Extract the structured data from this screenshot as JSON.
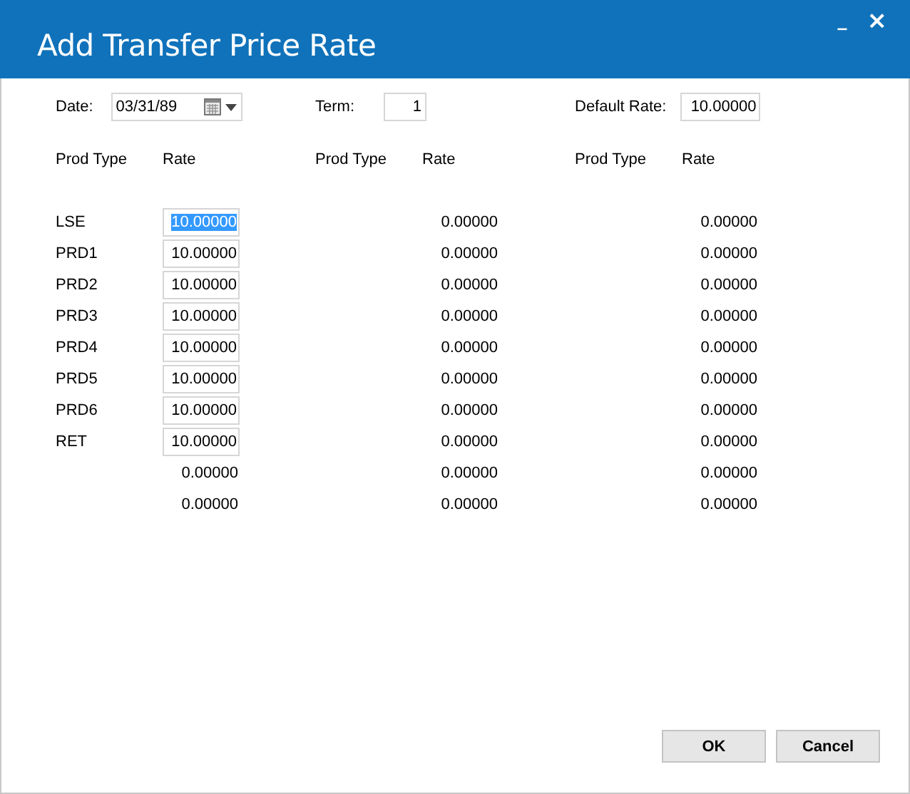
{
  "window": {
    "title": "Add Transfer Price Rate",
    "controls": [
      {
        "kind": "minimize",
        "label": "_"
      },
      {
        "kind": "close",
        "label": "×"
      }
    ]
  },
  "fields": {
    "date": {
      "label": "Date:",
      "value": "03/31/89"
    },
    "term": {
      "label": "Term:",
      "value": "1"
    },
    "default_rate": {
      "label": "Default Rate:",
      "value": "10.00000"
    }
  },
  "groups": [
    {
      "headers": [
        "Prod Type",
        "Rate"
      ],
      "rows": [
        {
          "kind": "input",
          "prod_type": "LSE",
          "rate": "10.00000",
          "selected": true
        },
        {
          "kind": "input",
          "prod_type": "PRD1",
          "rate": "10.00000",
          "selected": false
        },
        {
          "kind": "input",
          "prod_type": "PRD2",
          "rate": "10.00000",
          "selected": false
        },
        {
          "kind": "input",
          "prod_type": "PRD3",
          "rate": "10.00000",
          "selected": false
        },
        {
          "kind": "input",
          "prod_type": "PRD4",
          "rate": "10.00000",
          "selected": false
        },
        {
          "kind": "input",
          "prod_type": "PRD5",
          "rate": "10.00000",
          "selected": false
        },
        {
          "kind": "input",
          "prod_type": "PRD6",
          "rate": "10.00000",
          "selected": false
        },
        {
          "kind": "input",
          "prod_type": "RET",
          "rate": "10.00000",
          "selected": false
        },
        {
          "kind": "text",
          "rate": "0.00000"
        },
        {
          "kind": "text",
          "rate": "0.00000"
        }
      ]
    },
    {
      "headers": [
        "Prod Type",
        "Rate"
      ],
      "rows": [
        {
          "kind": "text",
          "rate": "0.00000"
        },
        {
          "kind": "text",
          "rate": "0.00000"
        },
        {
          "kind": "text",
          "rate": "0.00000"
        },
        {
          "kind": "text",
          "rate": "0.00000"
        },
        {
          "kind": "text",
          "rate": "0.00000"
        },
        {
          "kind": "text",
          "rate": "0.00000"
        },
        {
          "kind": "text",
          "rate": "0.00000"
        },
        {
          "kind": "text",
          "rate": "0.00000"
        },
        {
          "kind": "text",
          "rate": "0.00000"
        },
        {
          "kind": "text",
          "rate": "0.00000"
        }
      ]
    },
    {
      "headers": [
        "Prod Type",
        "Rate"
      ],
      "rows": [
        {
          "kind": "text",
          "rate": "0.00000"
        },
        {
          "kind": "text",
          "rate": "0.00000"
        },
        {
          "kind": "text",
          "rate": "0.00000"
        },
        {
          "kind": "text",
          "rate": "0.00000"
        },
        {
          "kind": "text",
          "rate": "0.00000"
        },
        {
          "kind": "text",
          "rate": "0.00000"
        },
        {
          "kind": "text",
          "rate": "0.00000"
        },
        {
          "kind": "text",
          "rate": "0.00000"
        },
        {
          "kind": "text",
          "rate": "0.00000"
        },
        {
          "kind": "text",
          "rate": "0.00000"
        }
      ]
    }
  ],
  "buttons": [
    "OK",
    "Cancel"
  ]
}
